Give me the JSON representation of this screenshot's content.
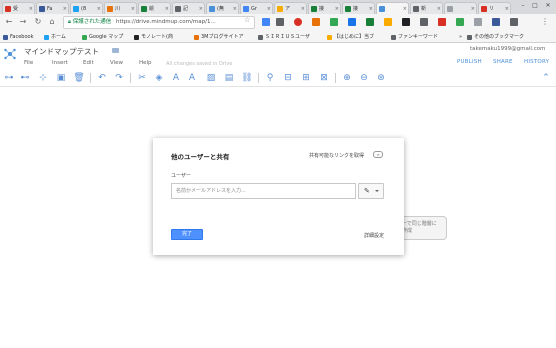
{
  "browser": {
    "tabs": [
      {
        "label": "受",
        "color": "#d93025",
        "icon": "gmail-icon"
      },
      {
        "label": "Fa",
        "color": "#3b5998",
        "icon": "facebook-icon"
      },
      {
        "label": "(8",
        "color": "#1da1f2",
        "icon": "twitter-icon"
      },
      {
        "label": "川",
        "color": "#e8710a",
        "icon": "blog-icon"
      },
      {
        "label": "絵",
        "color": "#188038",
        "icon": "page-icon"
      },
      {
        "label": "記",
        "color": "#5f6368",
        "icon": "page-icon"
      },
      {
        "label": "(無",
        "color": "#4a90d9",
        "icon": "page-icon"
      },
      {
        "label": "Gr",
        "color": "#4285f4",
        "icon": "page-icon"
      },
      {
        "label": "ア",
        "color": "#f9ab00",
        "icon": "page-icon"
      },
      {
        "label": "接",
        "color": "#188038",
        "icon": "drive-icon"
      },
      {
        "label": "接",
        "color": "#188038",
        "icon": "drive-icon"
      },
      {
        "label": "",
        "color": "#4a90d9",
        "icon": "mindmup-icon"
      },
      {
        "label": "新",
        "color": "#5f6368",
        "icon": "page-icon"
      },
      {
        "label": "",
        "color": "#9aa0a6",
        "icon": "page-icon"
      },
      {
        "label": "リ",
        "color": "#d93025",
        "icon": "page-icon"
      }
    ],
    "active_tab_index": 11,
    "close_glyph": "×",
    "omnibox": {
      "secure_text": "保護された通信",
      "url": "https://drive.mindmup.com/map/1..."
    },
    "bookmarks": [
      {
        "label": "Facebook",
        "color": "#3b5998"
      },
      {
        "label": "ホーム",
        "color": "#1da1f2"
      },
      {
        "label": "Google マップ",
        "color": "#34a853"
      },
      {
        "label": "モノレート(商",
        "color": "#222222"
      },
      {
        "label": "3Mブログサイトア",
        "color": "#e8710a"
      },
      {
        "label": "ＳＩＲＩＵＳユーザ",
        "color": "#5f6368"
      },
      {
        "label": "【はじめに】当ブ",
        "color": "#f9ab00"
      },
      {
        "label": "ファンキーワード",
        "color": "#5f6368"
      },
      {
        "label": "その他のブックマーク",
        "color": "#5f6368"
      }
    ],
    "bookmarks_overflow": "»"
  },
  "app": {
    "doc_title": "マインドマップテスト",
    "menu": [
      "File",
      "Insert",
      "Edit",
      "View",
      "Help"
    ],
    "saved_status": "All changes saved in Drive",
    "user_email": "takemaku1999@gmail.com",
    "actions": [
      "PUBLISH",
      "SHARE",
      "HISTORY"
    ]
  },
  "canvas": {
    "node_text_1": "ーで同じ階層に",
    "node_text_2": "作成"
  },
  "dialog": {
    "title": "他のユーザーと共有",
    "shareable_link": "共有可能なリンクを取得",
    "users_label": "ユーザー",
    "input_placeholder": "名前かメールアドレスを入力...",
    "done_label": "完了",
    "advanced_label": "詳細設定"
  },
  "colors": {
    "accent": "#4d90fe",
    "link": "#4a90d9",
    "secure": "#0b8043"
  }
}
